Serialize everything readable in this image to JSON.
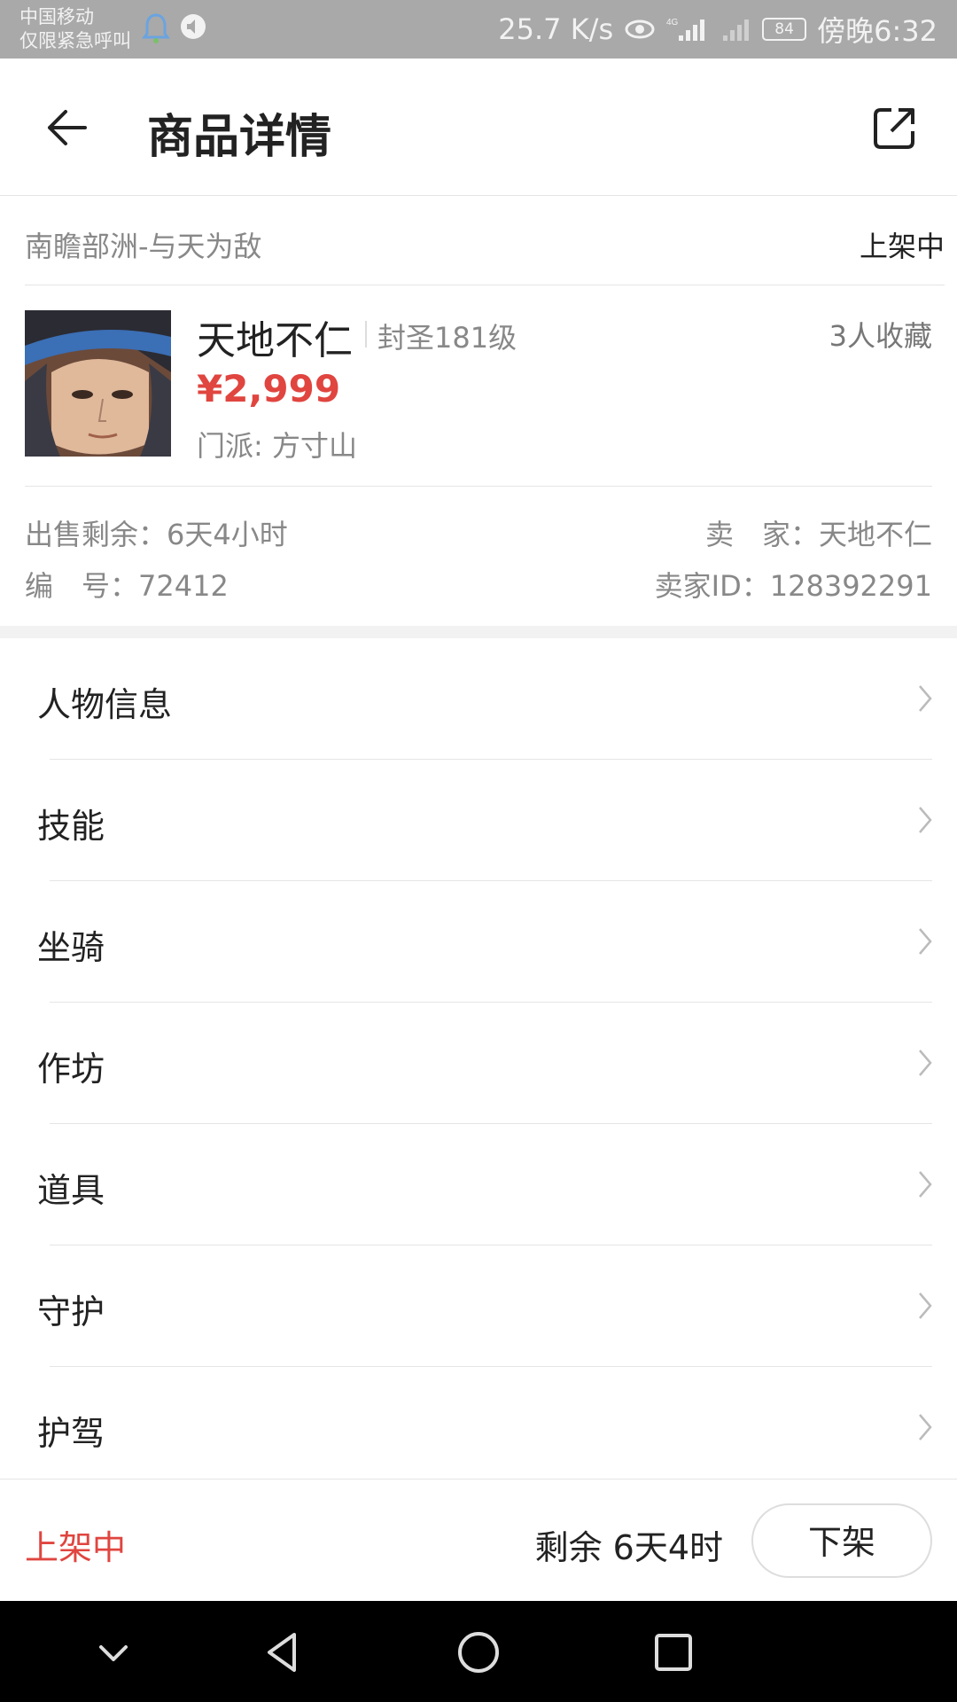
{
  "status_bar": {
    "carrier_line1": "中国移动",
    "carrier_line2": "仅限紧急呼叫",
    "net_speed": "25.7 K/s",
    "network_type": "4G",
    "battery": "84",
    "time": "傍晚6:32"
  },
  "header": {
    "title": "商品详情",
    "back_icon": "arrow-left-icon",
    "share_icon": "share-external-icon"
  },
  "server": {
    "name": "南瞻部洲-与天为敌",
    "status": "上架中"
  },
  "item": {
    "name": "天地不仁",
    "level": "封圣181级",
    "favorites": "3人收藏",
    "price": "¥2,999",
    "school": "门派: 方寸山"
  },
  "info": {
    "remaining_label": "出售剩余：6天4小时",
    "seller_label": "卖　家：天地不仁",
    "number_label": "编　号：72412",
    "seller_id_label": "卖家ID：128392291"
  },
  "menu": [
    {
      "label": "人物信息"
    },
    {
      "label": "技能"
    },
    {
      "label": "坐骑"
    },
    {
      "label": "作坊"
    },
    {
      "label": "道具"
    },
    {
      "label": "守护"
    },
    {
      "label": "护驾"
    }
  ],
  "action_bar": {
    "status": "上架中",
    "remaining": "剩余 6天4时",
    "delist_button": "下架"
  },
  "colors": {
    "accent_red": "#e0453f",
    "status_bar": "#a9a9a9",
    "nav_bar": "#000000"
  }
}
